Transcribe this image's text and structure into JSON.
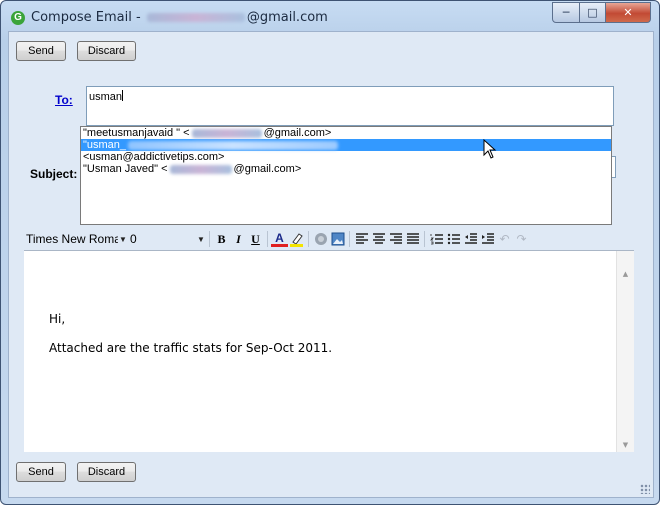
{
  "window": {
    "app_icon_letter": "G",
    "title_prefix": "Compose Email - ",
    "title_suffix": "@gmail.com"
  },
  "buttons": {
    "send": "Send",
    "discard": "Discard"
  },
  "fields": {
    "to_label": "To:",
    "to_value": "usman",
    "subject_label": "Subject:",
    "subject_value": ""
  },
  "suggestions": [
    {
      "prefix": "\"meetusmanjavaid \" <",
      "suffix": "@gmail.com>",
      "selected": false
    },
    {
      "prefix": "\"usman_",
      "suffix": "",
      "selected": true
    },
    {
      "prefix": "<usman@addictivetips.com>",
      "suffix": "",
      "selected": false
    },
    {
      "prefix": "\"Usman Javed\" <",
      "suffix": "@gmail.com>",
      "selected": false
    }
  ],
  "toolbar": {
    "font_family": "Times New Roman",
    "font_size": "0",
    "bold": "B",
    "italic": "I",
    "underline": "U",
    "font_color_glyph": "A"
  },
  "editor": {
    "greeting": "Hi,",
    "body": "Attached are the traffic stats for Sep-Oct 2011."
  },
  "colors": {
    "link_blue": "#0000cc",
    "selection_blue": "#3399ff",
    "close_red": "#c24a34"
  }
}
